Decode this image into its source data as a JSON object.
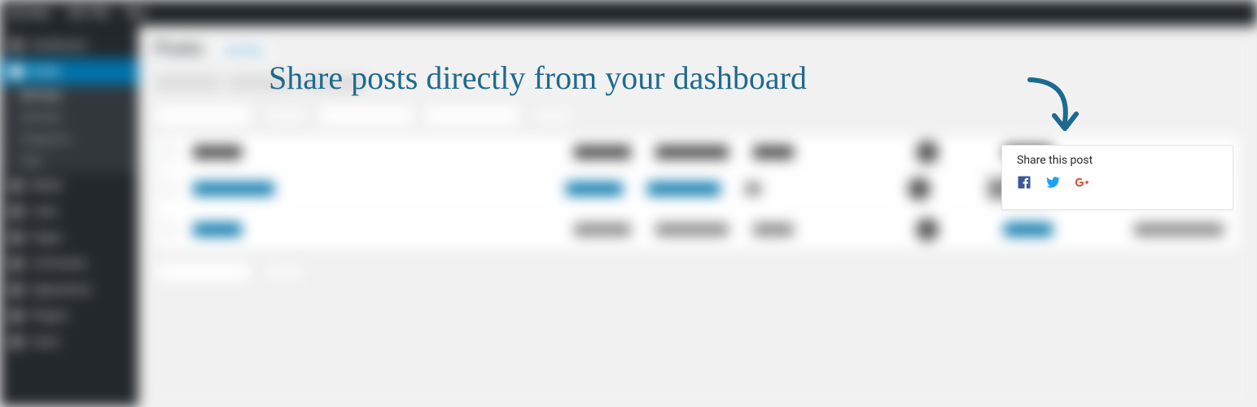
{
  "overlay": {
    "headline": "Share posts directly from your dashboard",
    "share_title": "Share this post",
    "icons": {
      "facebook": "facebook-icon",
      "twitter": "twitter-icon",
      "googleplus": "googleplus-icon"
    }
  },
  "admin": {
    "topbar": [
      "My Sites",
      "Site Title",
      "0",
      "New"
    ],
    "sidebar": {
      "dashboard": "Dashboard",
      "posts": "Posts",
      "subs": [
        "All Posts",
        "Add New",
        "Categories",
        "Tags"
      ],
      "items": [
        "Media",
        "Links",
        "Pages",
        "Comments",
        "Appearance",
        "Plugins",
        "Users"
      ]
    },
    "page_title": "Posts",
    "add_new": "Add New",
    "bulk": "Bulk Actions",
    "apply": "Apply",
    "columns": [
      "Title",
      "Author",
      "Categories",
      "Tags",
      "Comments",
      "Date",
      "Share"
    ]
  }
}
